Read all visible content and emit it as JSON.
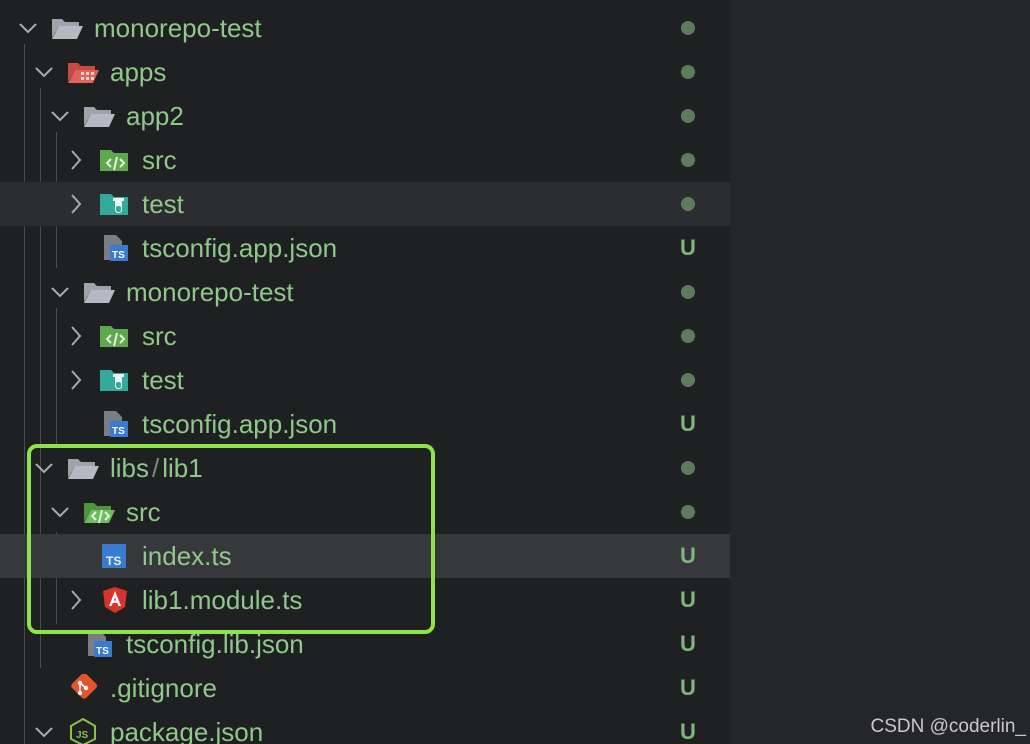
{
  "explorer": {
    "rows": [
      {
        "label": "monorepo-test",
        "status": "dot"
      },
      {
        "label": "apps",
        "status": "dot"
      },
      {
        "label": "app2",
        "status": "dot"
      },
      {
        "label": "src",
        "status": "dot"
      },
      {
        "label": "test",
        "status": "dot"
      },
      {
        "label": "tsconfig.app.json",
        "status": "U"
      },
      {
        "label": "monorepo-test",
        "status": "dot"
      },
      {
        "label": "src",
        "status": "dot"
      },
      {
        "label": "test",
        "status": "dot"
      },
      {
        "label": "tsconfig.app.json",
        "status": "U"
      },
      {
        "label_parts": [
          "libs",
          "/",
          "lib1"
        ],
        "status": "dot"
      },
      {
        "label": "src",
        "status": "dot"
      },
      {
        "label": "index.ts",
        "status": "U"
      },
      {
        "label": "lib1.module.ts",
        "status": "U"
      },
      {
        "label": "tsconfig.lib.json",
        "status": "U"
      },
      {
        "label": ".gitignore",
        "status": "U"
      },
      {
        "label": "package.json",
        "status": "U"
      }
    ]
  },
  "icons": [
    "folder-open-icon",
    "folder-apps-icon",
    "folder-open-icon",
    "folder-src-icon",
    "folder-test-icon",
    "typescript-config-icon",
    "folder-open-icon",
    "folder-src-icon",
    "folder-test-icon",
    "typescript-config-icon",
    "folder-open-icon",
    "folder-src-open-icon",
    "typescript-file-icon",
    "angular-icon",
    "typescript-config-icon",
    "git-icon",
    "javascript-package-icon"
  ],
  "colors": {
    "label": "#8fc88a",
    "status_dot": "#5d7d5a",
    "untracked_badge": "#7fb57d",
    "focus_outline": "#8ce34a",
    "typescript_blue": "#3a7bd0",
    "angular_red": "#d8322d",
    "git_orange": "#e2562c"
  },
  "watermark": "CSDN @coderlin_"
}
